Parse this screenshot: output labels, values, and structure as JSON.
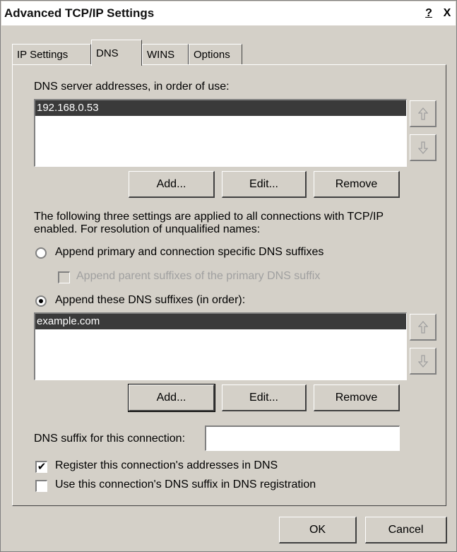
{
  "window": {
    "title": "Advanced TCP/IP Settings",
    "help_label": "?",
    "close_label": "X"
  },
  "tabs": [
    {
      "label": "IP Settings"
    },
    {
      "label": "DNS"
    },
    {
      "label": "WINS"
    },
    {
      "label": "Options"
    }
  ],
  "dns_servers": {
    "label": "DNS server addresses, in order of use:",
    "items": [
      "192.168.0.53"
    ],
    "add_label": "Add...",
    "edit_label": "Edit...",
    "remove_label": "Remove"
  },
  "description": {
    "line1": "The following three settings are applied to all connections with TCP/IP",
    "line2": "enabled. For resolution of unqualified names:"
  },
  "options": {
    "append_primary": "Append primary and connection specific DNS suffixes",
    "append_parent": "Append parent suffixes of the primary DNS suffix",
    "append_these": "Append these DNS suffixes (in order):"
  },
  "dns_suffixes": {
    "items": [
      "example.com"
    ],
    "add_label": "Add...",
    "edit_label": "Edit...",
    "remove_label": "Remove"
  },
  "suffix_field": {
    "label": "DNS suffix for this connection:",
    "value": ""
  },
  "register": {
    "addresses_label": "Register this connection's addresses in DNS",
    "use_suffix_label": "Use this connection's DNS suffix in DNS registration"
  },
  "footer": {
    "ok_label": "OK",
    "cancel_label": "Cancel"
  }
}
